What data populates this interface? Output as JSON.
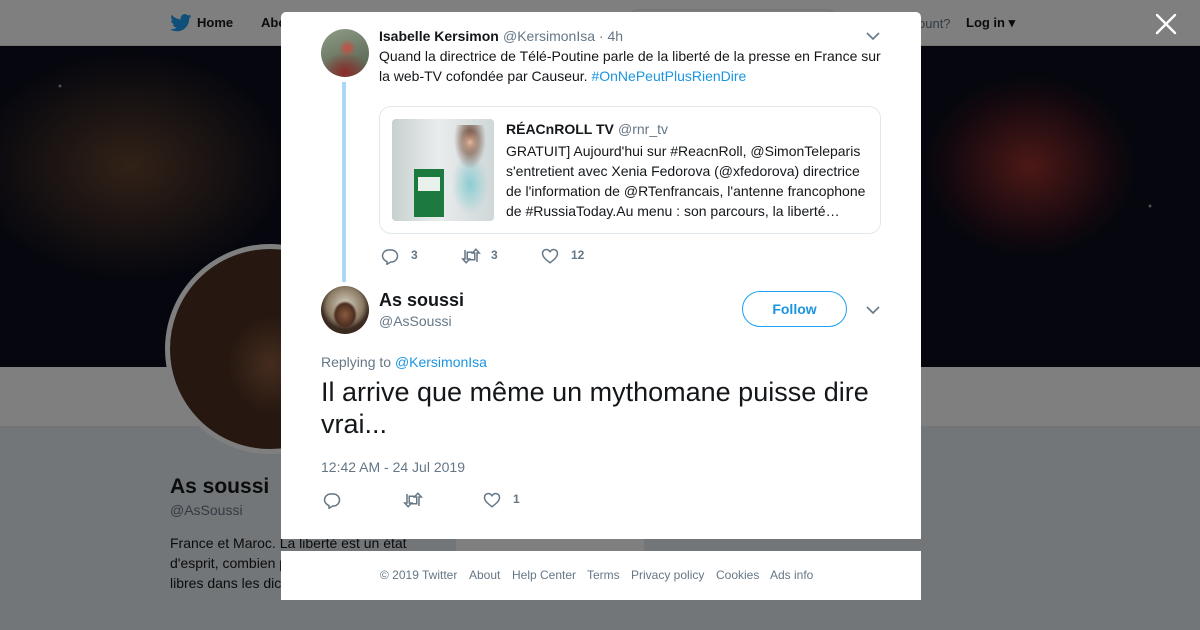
{
  "background": {
    "nav": {
      "home_label": "Home",
      "about_label": "Abo",
      "account_prompt": "ccount?",
      "login_label": "Log in"
    },
    "profile": {
      "name": "As soussi",
      "handle": "@AsSoussi",
      "bio": "France et Maroc. La liberté est un état d'esprit, combien pays démocratiqu libres dans les dictatures?"
    }
  },
  "thread": {
    "parent": {
      "author_name": "Isabelle Kersimon",
      "author_handle": "@KersimonIsa",
      "time": "· 4h",
      "text": "Quand la directrice de Télé-Poutine parle de la liberté de la presse en France sur la web-TV cofondée par Causeur. ",
      "hashtag": "#OnNePeutPlusRienDire",
      "quoted": {
        "author_name": "RÉACnROLL TV",
        "author_handle": "@rnr_tv",
        "text": "GRATUIT] Aujourd'hui sur #ReacnRoll, @SimonTeleparis s'entretient avec Xenia Fedorova (@xfedorova) directrice de l'information de @RTenfrancais, l'antenne francophone de #RussiaToday.Au menu : son parcours, la liberté…"
      },
      "stats": {
        "replies": "3",
        "retweets": "3",
        "likes": "12"
      }
    },
    "main": {
      "author_name": "As soussi",
      "author_handle": "@AsSoussi",
      "follow_label": "Follow",
      "replying_prefix": "Replying to ",
      "replying_to": "@KersimonIsa",
      "text": "Il arrive que même un mythomane puisse dire vrai...",
      "timestamp": "12:42 AM - 24 Jul 2019",
      "stats": {
        "replies": "",
        "retweets": "",
        "likes": "1"
      }
    }
  },
  "footer": {
    "copyright": "© 2019 Twitter",
    "links": [
      "About",
      "Help Center",
      "Terms",
      "Privacy policy",
      "Cookies",
      "Ads info"
    ]
  },
  "colors": {
    "accent": "#1da1f2",
    "link": "#1b95e0",
    "muted": "#657786",
    "thread_line": "#aad8f5"
  },
  "icons": [
    "twitter-bird-icon",
    "close-icon",
    "chevron-down-icon",
    "reply-icon",
    "retweet-icon",
    "like-icon"
  ]
}
